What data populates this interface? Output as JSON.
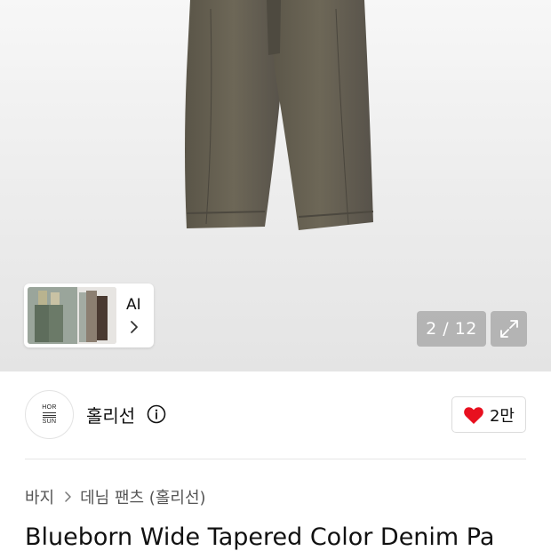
{
  "gallery": {
    "ai_label": "AI",
    "counter_current": "2",
    "counter_separator": "/",
    "counter_total": "12"
  },
  "brand": {
    "logo_line1": "HOR",
    "logo_line2": "SUN",
    "name": "홀리선",
    "likes": "2만",
    "like_color": "#e8101f"
  },
  "breadcrumb": {
    "items": [
      "바지",
      "데님 팬츠 (홀리선)"
    ]
  },
  "product": {
    "title": "Blueborn Wide Tapered Color Denim Pa"
  },
  "icons": [
    "chevron-right-icon",
    "expand-icon",
    "info-icon",
    "heart-icon"
  ]
}
